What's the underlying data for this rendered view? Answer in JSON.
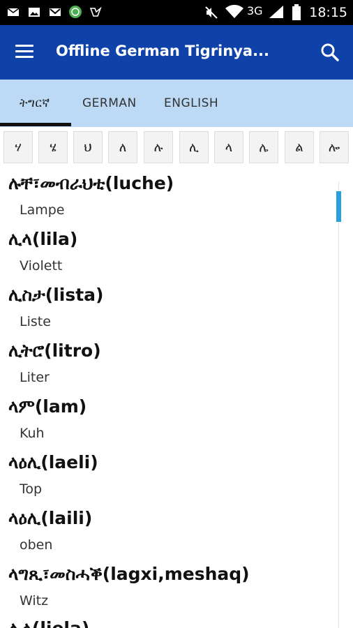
{
  "status_bar": {
    "time": "18:15",
    "network": "3G",
    "icons": [
      "mail-icon",
      "image-icon",
      "gmail-icon",
      "whatsapp-icon",
      "check-icon",
      "mute-icon",
      "wifi-icon",
      "signal-icon",
      "battery-icon"
    ]
  },
  "app_bar": {
    "title": "Offline German Tigrinya...",
    "menu_icon": "menu-icon",
    "search_icon": "search-icon"
  },
  "tabs": [
    {
      "label": "ትግርኛ",
      "active": true
    },
    {
      "label": "GERMAN",
      "active": false
    },
    {
      "label": "ENGLISH",
      "active": false
    }
  ],
  "alphabet": [
    "ሃ",
    "ሄ",
    "ህ",
    "ለ",
    "ሉ",
    "ሊ",
    "ላ",
    "ሌ",
    "ል",
    "ሎ"
  ],
  "entries": [
    {
      "term": "ሉቸ፣መብራህቲ(luche)",
      "translation": "Lampe"
    },
    {
      "term": "ሊላ(lila)",
      "translation": "Violett"
    },
    {
      "term": "ሊስታ(lista)",
      "translation": "Liste"
    },
    {
      "term": "ሊትሮ(litro)",
      "translation": "Liter"
    },
    {
      "term": "ላም(lam)",
      "translation": "Kuh"
    },
    {
      "term": "ላዕሊ(laeli)",
      "translation": "Top"
    },
    {
      "term": "ላዕሊ(laili)",
      "translation": "oben"
    },
    {
      "term": "ላግጺ፣መስሓቕ(lagxi,meshaq)",
      "translation": "Witz"
    },
    {
      "term": "ሊላ(liela)",
      "translation": ""
    }
  ],
  "colors": {
    "app_bar": "#0f42a8",
    "tab_bar": "#bcdaf5",
    "scroll_thumb": "#2a9fd8"
  }
}
